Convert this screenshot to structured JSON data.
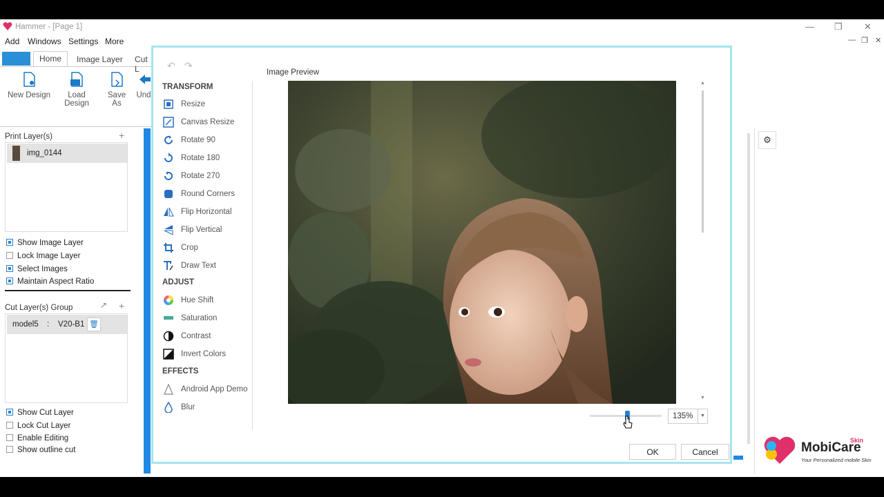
{
  "window": {
    "title": "Hammer - [Page 1]"
  },
  "menu": {
    "items": [
      "Add",
      "Windows",
      "Settings",
      "More"
    ]
  },
  "ribbon": {
    "tabs": [
      "Home",
      "Image Layer",
      "Cut L"
    ],
    "buttons": [
      {
        "label": "New Design",
        "icon": "new-design-icon"
      },
      {
        "label": "Load Design",
        "icon": "load-design-icon"
      },
      {
        "label": "Save As",
        "icon": "save-as-icon"
      },
      {
        "label": "Und",
        "icon": "undo-icon"
      }
    ]
  },
  "print_layers": {
    "header": "Print Layer(s)",
    "items": [
      {
        "name": "img_0144"
      }
    ],
    "options": [
      {
        "label": "Show Image Layer",
        "checked": true
      },
      {
        "label": "Lock Image Layer",
        "checked": false
      },
      {
        "label": "Select Images",
        "checked": true
      },
      {
        "label": "Maintain Aspect Ratio",
        "checked": true
      }
    ]
  },
  "cut_layers": {
    "header": "Cut Layer(s) Group",
    "items": [
      {
        "model": "model5",
        "separator": ":",
        "variant": "V20-B1"
      }
    ],
    "options": [
      {
        "label": "Show Cut Layer",
        "checked": true
      },
      {
        "label": "Lock Cut Layer",
        "checked": false
      },
      {
        "label": "Enable Editing",
        "checked": false
      },
      {
        "label": "Show outline cut",
        "checked": false
      }
    ]
  },
  "editor": {
    "sections": {
      "transform": "TRANSFORM",
      "adjust": "ADJUST",
      "effects": "EFFECTS"
    },
    "transform_tools": [
      "Resize",
      "Canvas Resize",
      "Rotate 90",
      "Rotate 180",
      "Rotate 270",
      "Round Corners",
      "Flip Horizontal",
      "Flip Vertical",
      "Crop",
      "Draw Text"
    ],
    "adjust_tools": [
      "Hue Shift",
      "Saturation",
      "Contrast",
      "Invert Colors"
    ],
    "effect_tools": [
      "Android App Demo",
      "Blur"
    ],
    "preview_label": "Image Preview",
    "zoom": {
      "value": "135%",
      "slider_fraction": 0.5
    },
    "ok_label": "OK",
    "cancel_label": "Cancel"
  },
  "brand": {
    "name": "MobiCare",
    "badge": "Skin",
    "tagline": "Your Personalized mobile Skin"
  }
}
